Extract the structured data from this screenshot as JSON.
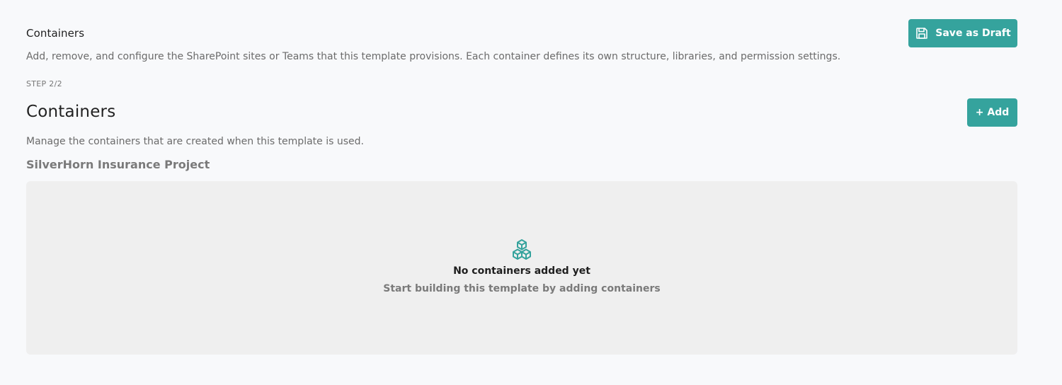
{
  "header": {
    "title": "Containers",
    "save_draft_label": "Save as Draft",
    "description": "Add, remove, and configure the SharePoint sites or Teams that this template provisions. Each container defines its own structure, libraries, and permission settings."
  },
  "step": "STEP 2/2",
  "section": {
    "title": "Containers",
    "add_label": "+ Add",
    "description": "Manage the containers that are created when this template is used.",
    "project_name": "SilverHorn Insurance Project"
  },
  "empty_state": {
    "icon": "cubes-icon",
    "title": "No containers added yet",
    "subtitle": "Start building this template by adding containers"
  },
  "colors": {
    "accent": "#35a39d",
    "background": "#f8f9fb",
    "panel": "#efefef"
  }
}
